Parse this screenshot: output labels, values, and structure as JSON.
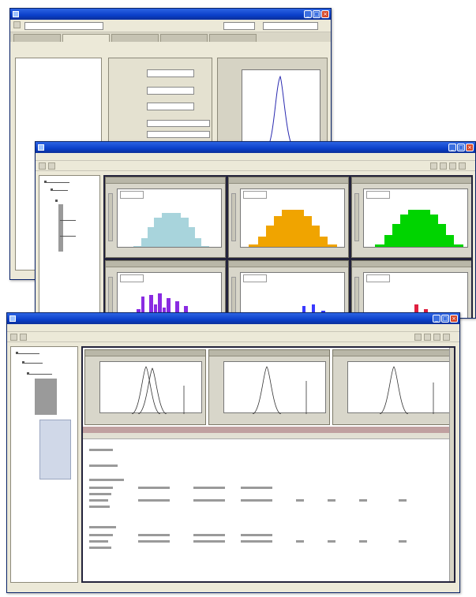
{
  "windows": {
    "back": {
      "title": "",
      "controls": [
        "_",
        "□",
        "×"
      ],
      "tabs": [
        "",
        "",
        "",
        "",
        ""
      ]
    },
    "middle": {
      "title": "",
      "controls": [
        "_",
        "□",
        "×"
      ],
      "chart_panels": [
        {
          "legend": "",
          "color": "#a8d4dc",
          "shape": "bell"
        },
        {
          "legend": "",
          "color": "#f0a400",
          "shape": "bell"
        },
        {
          "legend": "",
          "color": "#00d400",
          "shape": "bell"
        },
        {
          "legend": "",
          "color": "#8a2be2",
          "shape": "spiky"
        },
        {
          "legend": "",
          "color": "#3a3aff",
          "shape": "spiky-right"
        },
        {
          "legend": "",
          "color": "#e02040",
          "shape": "spiky-right"
        }
      ]
    },
    "front": {
      "title": "",
      "controls": [
        "_",
        "□",
        "×"
      ]
    }
  },
  "colors": {
    "titlebar": "#0a3fc9",
    "window_bg": "#ece9d8",
    "frame_border": "#23233b"
  }
}
